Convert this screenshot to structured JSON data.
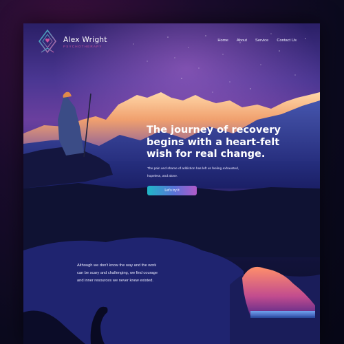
{
  "brand": {
    "name": "Alex Wright",
    "subtitle": "PSYCHOTHERAPY",
    "logo_icon": "heart-diamond-logo"
  },
  "nav": {
    "items": [
      {
        "label": "Home"
      },
      {
        "label": "About"
      },
      {
        "label": "Service"
      },
      {
        "label": "Contact Us"
      }
    ]
  },
  "hero": {
    "title_lines": [
      "The journey of recovery",
      "begins with a heart-felt",
      "wish for real change."
    ],
    "body_lines": [
      "The pain and shame of addiction has left us feeling exhausted,",
      "hopeless, and alone."
    ],
    "cta_label": "Let's try it"
  },
  "section2": {
    "body_lines": [
      "Although we don't know the way and the work",
      "can be scary and challenging, we find courage",
      "and inner resources we never knew existed."
    ]
  },
  "colors": {
    "accent_cyan": "#1fb7c7",
    "accent_magenta": "#c9539f",
    "accent_purple": "#b25ac9"
  }
}
